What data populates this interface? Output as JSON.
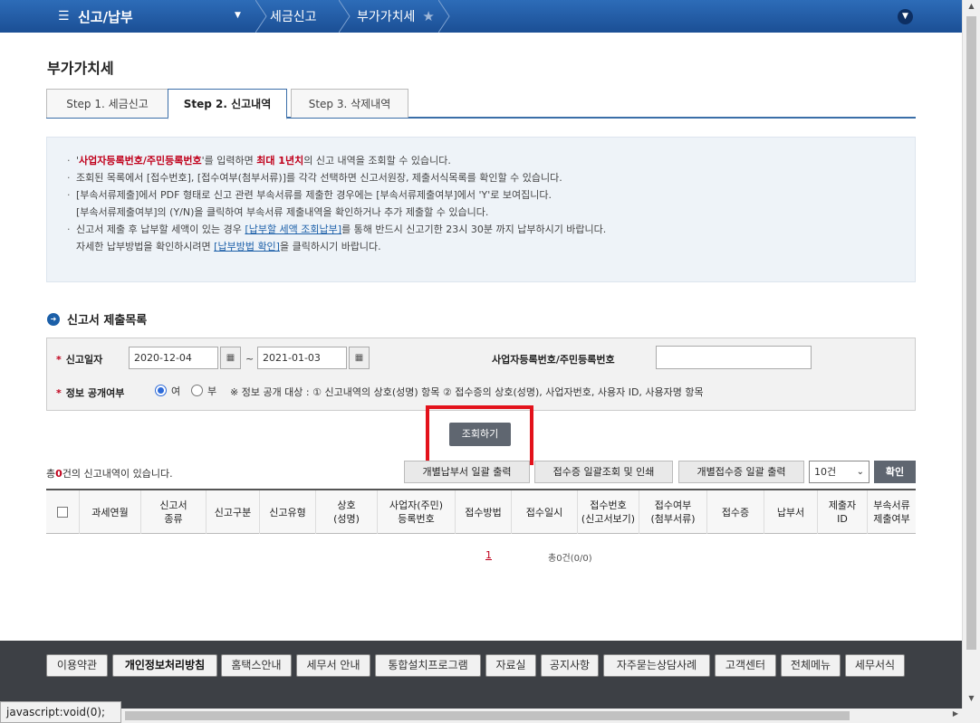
{
  "nav": {
    "menu_label": "신고/납부",
    "crumbs": [
      "세금신고",
      "부가가치세"
    ]
  },
  "page_title": "부가가치세",
  "tabs": [
    "Step 1. 세금신고",
    "Step 2. 신고내역",
    "Step 3. 삭제내역"
  ],
  "info": {
    "l1_q1": "'",
    "l1_red1": "사업자등록번호/주민등록번호",
    "l1_a": "'를 입력하면 ",
    "l1_red2": "최대 1년치",
    "l1_b": "의 신고 내역을 조회할 수 있습니다.",
    "l2": "조회된 목록에서 [접수번호], [접수여부(첨부서류)]를 각각 선택하면 신고서원장, 제출서식목록를 확인할 수 있습니다.",
    "l3": "[부속서류제출]에서 PDF 형태로 신고 관련 부속서류를 제출한 경우에는 [부속서류제출여부]에서 'Y'로 보여집니다.",
    "l3b": "[부속서류제출여부]의 (Y/N)을 클릭하여 부속서류 제출내역을 확인하거나 추가 제출할 수 있습니다.",
    "l4_a": "신고서 제출 후 납부할 세액이 있는 경우 ",
    "l4_link": "[납부할 세액 조회납부]",
    "l4_b": "를 통해 반드시 신고기한 23시 30분 까지 납부하시기 바랍니다.",
    "l5_a": "자세한 납부방법을 확인하시려면 ",
    "l5_link": "[납부방법 확인]",
    "l5_b": "을 클릭하시기 바랍니다."
  },
  "section_title": "신고서 제출목록",
  "search": {
    "date_label": "신고일자",
    "date_from": "2020-12-04",
    "date_to": "2021-01-03",
    "tilde": "~",
    "bizno_label": "사업자등록번호/주민등록번호",
    "bizno_value": "",
    "public_label": "정보 공개여부",
    "yes": "여",
    "no": "부",
    "public_note": "※ 정보 공개 대상 : ① 신고내역의 상호(성명) 항목 ② 접수증의 상호(성명), 사업자번호, 사용자 ID, 사용자명 항목",
    "button": "조회하기"
  },
  "list": {
    "count_prefix": "총",
    "count": "0",
    "count_suffix": "건의 신고내역이 있습니다.",
    "btn_pay": "개별납부서 일괄 출력",
    "btn_receipt": "접수증 일괄조회 및 인쇄",
    "btn_each": "개별접수증 일괄 출력",
    "page_size": "10건",
    "ok": "확인"
  },
  "table": {
    "headers": [
      "과세연월",
      "신고서\n종류",
      "신고구분",
      "신고유형",
      "상호\n(성명)",
      "사업자(주민)\n등록번호",
      "접수방법",
      "접수일시",
      "접수번호\n(신고서보기)",
      "접수여부\n(첨부서류)",
      "접수증",
      "납부서",
      "제출자\nID",
      "부속서류\n제출여부"
    ]
  },
  "pager": {
    "page": "1",
    "info": "총0건(0/0)"
  },
  "footer": {
    "links": [
      "이용약관",
      "개인정보처리방침",
      "홈택스안내",
      "세무서 안내",
      "통합설치프로그램",
      "자료실",
      "공지사항",
      "자주묻는상담사례",
      "고객센터",
      "전체메뉴",
      "세무서식"
    ]
  },
  "statusbar": "javascript:void(0);"
}
